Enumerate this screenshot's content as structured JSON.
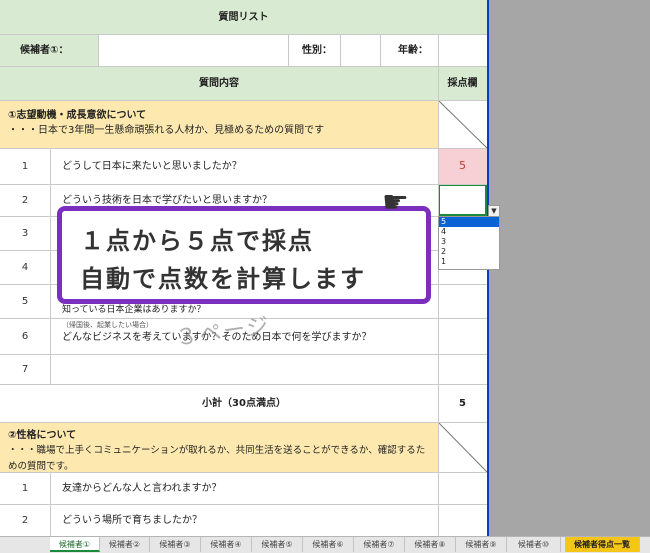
{
  "sheet": {
    "title": "質問リスト",
    "candidate_label": "候補者①：",
    "gender_label": "性別：",
    "age_label": "年齢：",
    "content_header": "質問内容",
    "score_header": "採点欄",
    "section1": {
      "title": "①志望動機・成長意欲について",
      "desc": "・・・日本で3年間一生懸命頑張れる人材か、見極めるための質問です"
    },
    "rows1": [
      {
        "no": "1",
        "q": "どうして日本に来たいと思いましたか？",
        "score": "5"
      },
      {
        "no": "2",
        "q": "どういう技術を日本で学びたいと思いますか？",
        "score": ""
      },
      {
        "no": "3",
        "q": "",
        "score": ""
      },
      {
        "no": "4",
        "q": "",
        "score": ""
      },
      {
        "no": "5",
        "q": "知っている日本企業はありますか？",
        "score": ""
      },
      {
        "no": "6",
        "q_note": "（帰国後、起業したい場合）",
        "q": "どんなビジネスを考えていますか？そのため日本で何を学びますか？",
        "score": ""
      },
      {
        "no": "7",
        "q": "",
        "score": ""
      }
    ],
    "subtotal_label": "小計（30点満点）",
    "subtotal_value": "5",
    "section2": {
      "title": "②性格について",
      "desc": "・・・職場で上手くコミュニケーションが取れるか、共同生活を送ることができるか、確認するための質問です。"
    },
    "rows2": [
      {
        "no": "1",
        "q": "友達からどんな人と言われますか？"
      },
      {
        "no": "2",
        "q": "どういう場所で育ちましたか？"
      }
    ]
  },
  "watermark": "３ページ",
  "dropdown": {
    "options": [
      "5",
      "4",
      "3",
      "2",
      "1"
    ],
    "selected": "5"
  },
  "callout": {
    "line1": "１点から５点で採点",
    "line2": "自動で点数を計算します"
  },
  "tabs": [
    "候補者①",
    "候補者②",
    "候補者③",
    "候補者④",
    "候補者⑤",
    "候補者⑥",
    "候補者⑦",
    "候補者⑧",
    "候補者⑨",
    "候補者⑩",
    "候補者得点一覧"
  ],
  "colors": {
    "header_green": "#d9ead3",
    "section_yellow": "#fde9b0",
    "highlight_pink": "#f7d0d5",
    "callout_purple": "#7b2fbf",
    "active_tab_green": "#1b8a3a",
    "summary_tab_yellow": "#f5c518"
  }
}
